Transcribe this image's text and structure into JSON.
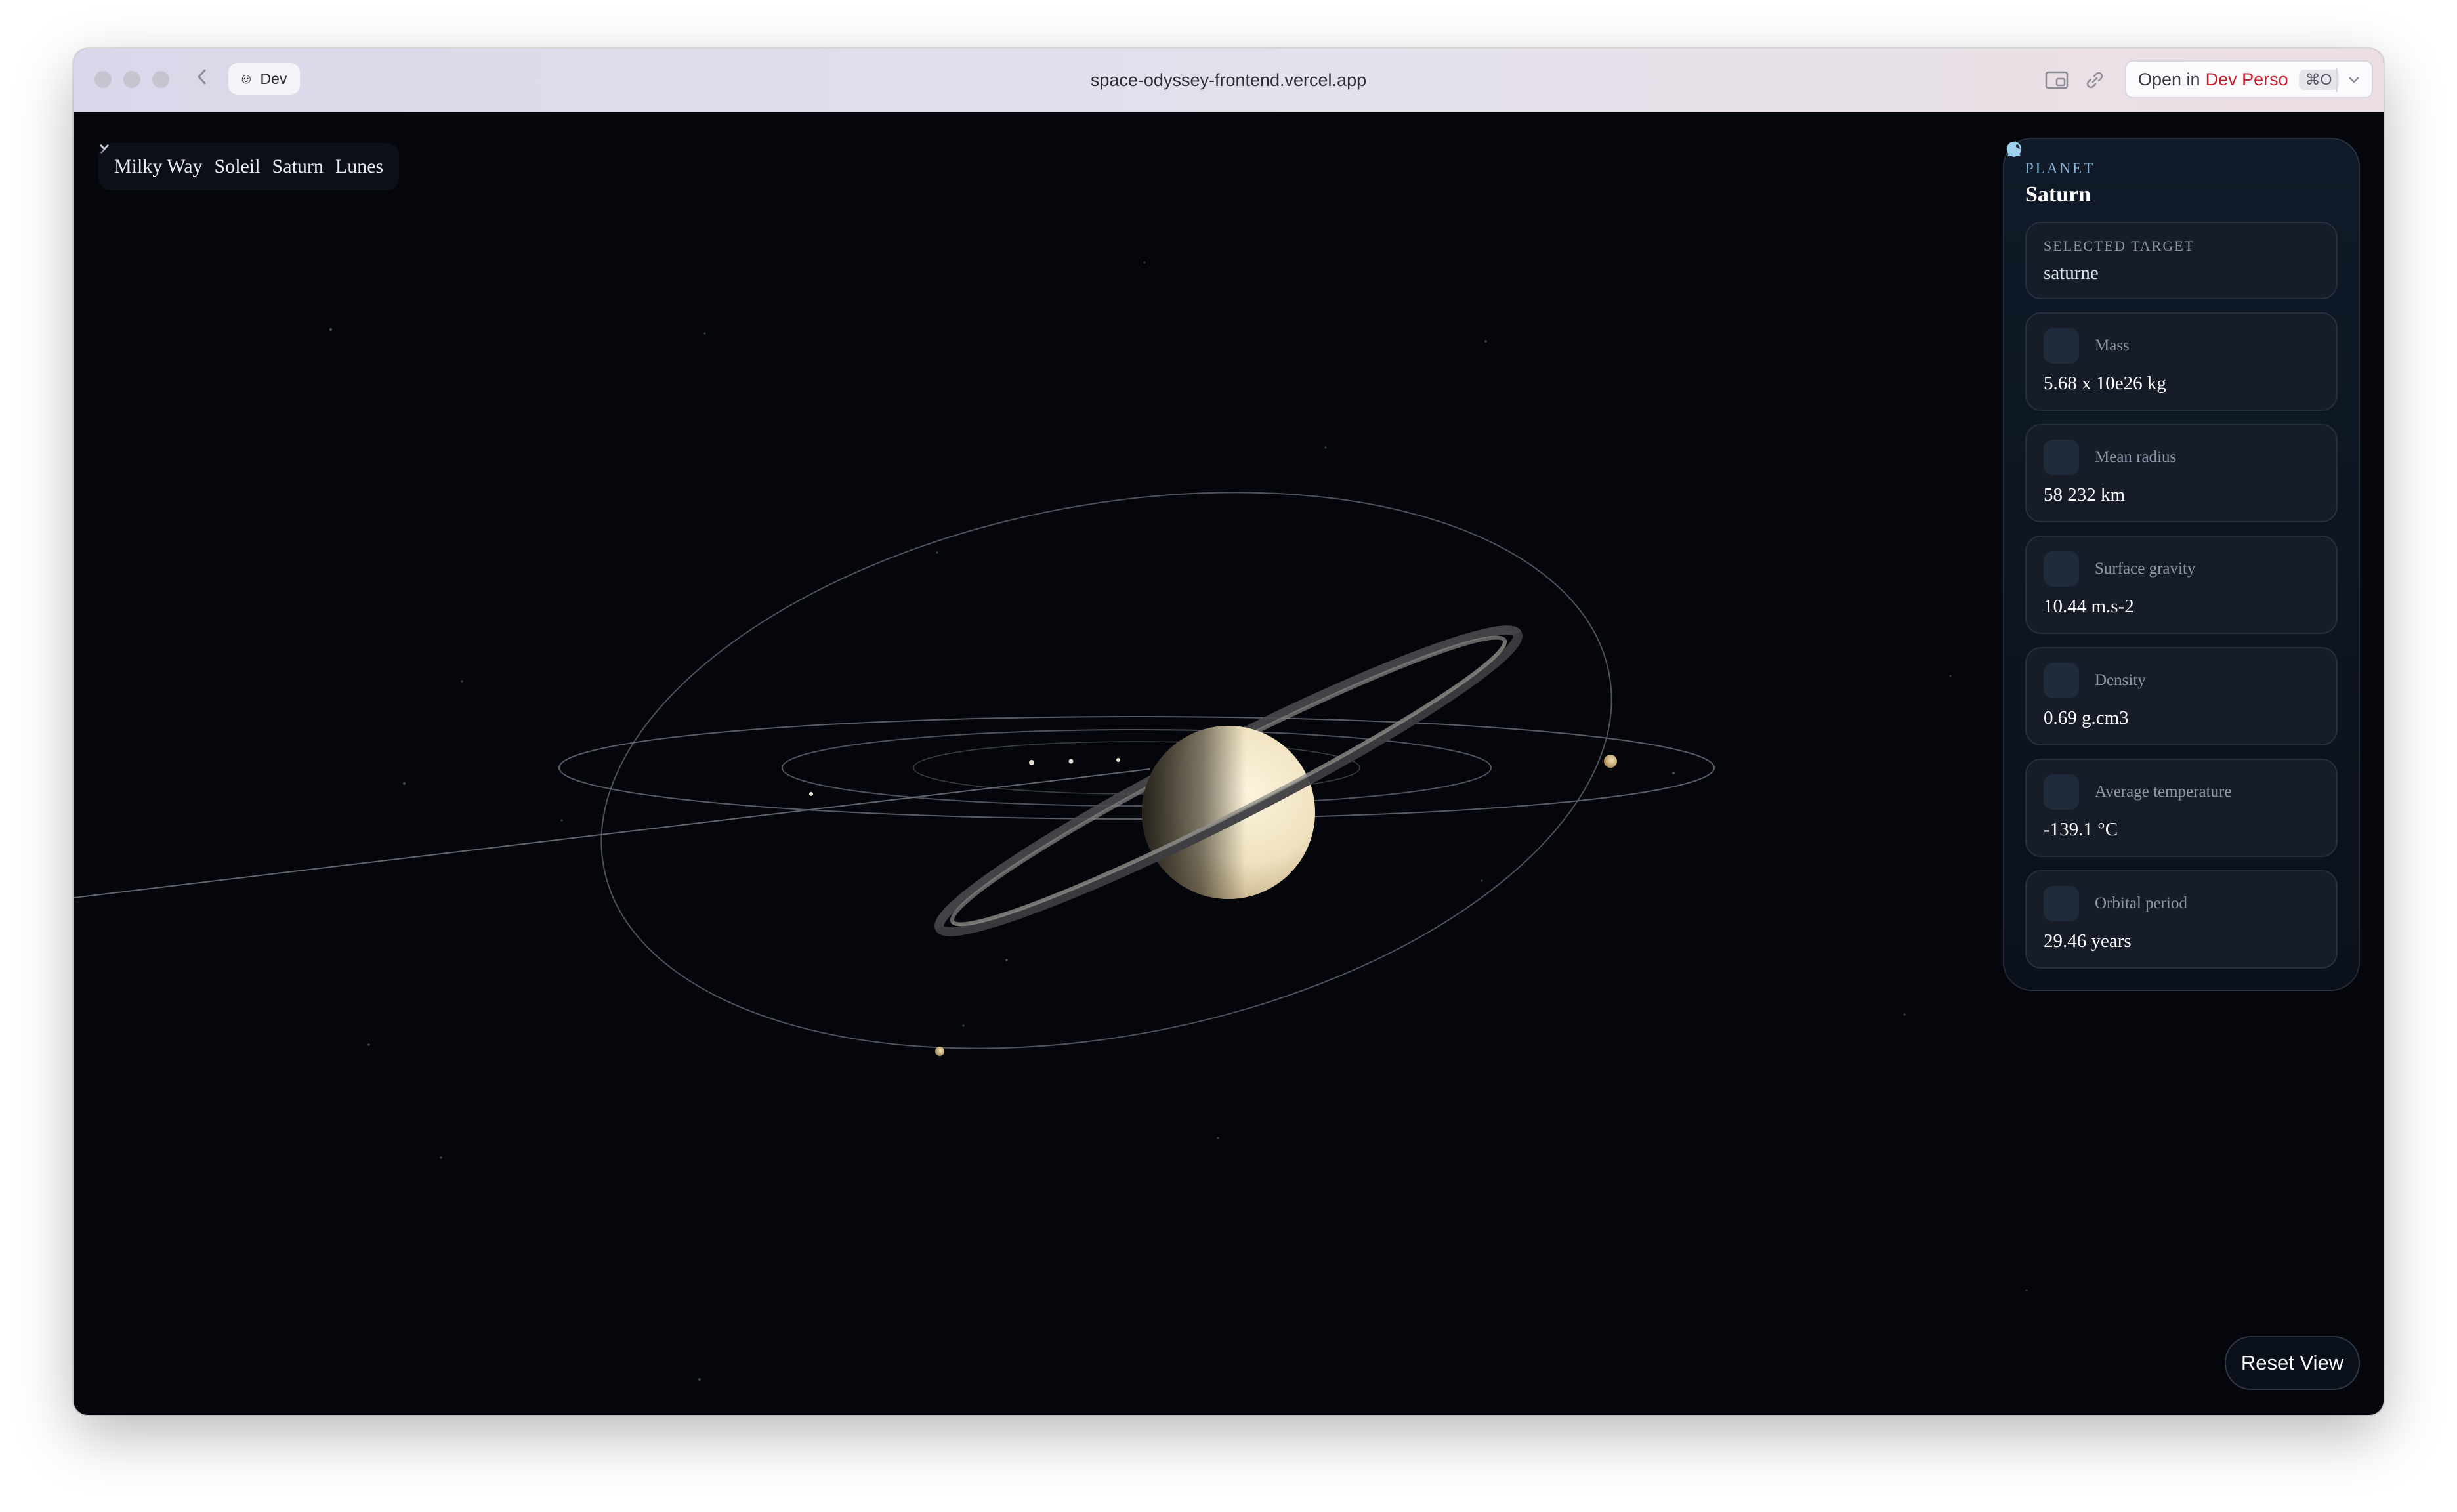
{
  "browser": {
    "profile_label": "Dev",
    "url": "space-odyssey-frontend.vercel.app",
    "open_in": {
      "prefix": "Open in",
      "target": "Dev Perso",
      "shortcut": "⌘O"
    }
  },
  "breadcrumb": [
    {
      "label": "Milky Way"
    },
    {
      "label": "Soleil"
    },
    {
      "label": "Saturn"
    },
    {
      "label": "Lunes"
    }
  ],
  "panel": {
    "kicker": "PLANET",
    "title": "Saturn",
    "target_label": "SELECTED TARGET",
    "target_value": "saturne",
    "stats": [
      {
        "icon": "mass-icon",
        "label": "Mass",
        "value": "5.68 x 10e26 kg"
      },
      {
        "icon": "radius-icon",
        "label": "Mean radius",
        "value": "58 232 km"
      },
      {
        "icon": "gravity-icon",
        "label": "Surface gravity",
        "value": "10.44 m.s-2"
      },
      {
        "icon": "density-icon",
        "label": "Density",
        "value": "0.69 g.cm3"
      },
      {
        "icon": "thermometer-icon",
        "label": "Average temperature",
        "value": "-139.1 °C"
      },
      {
        "icon": "orbit-icon",
        "label": "Orbital period",
        "value": "29.46 years"
      }
    ]
  },
  "reset_label": "Reset View",
  "colors": {
    "space": "#04060c",
    "panel": "#101a28",
    "accent": "#86b6d6",
    "saturn": "#efe2bf"
  }
}
